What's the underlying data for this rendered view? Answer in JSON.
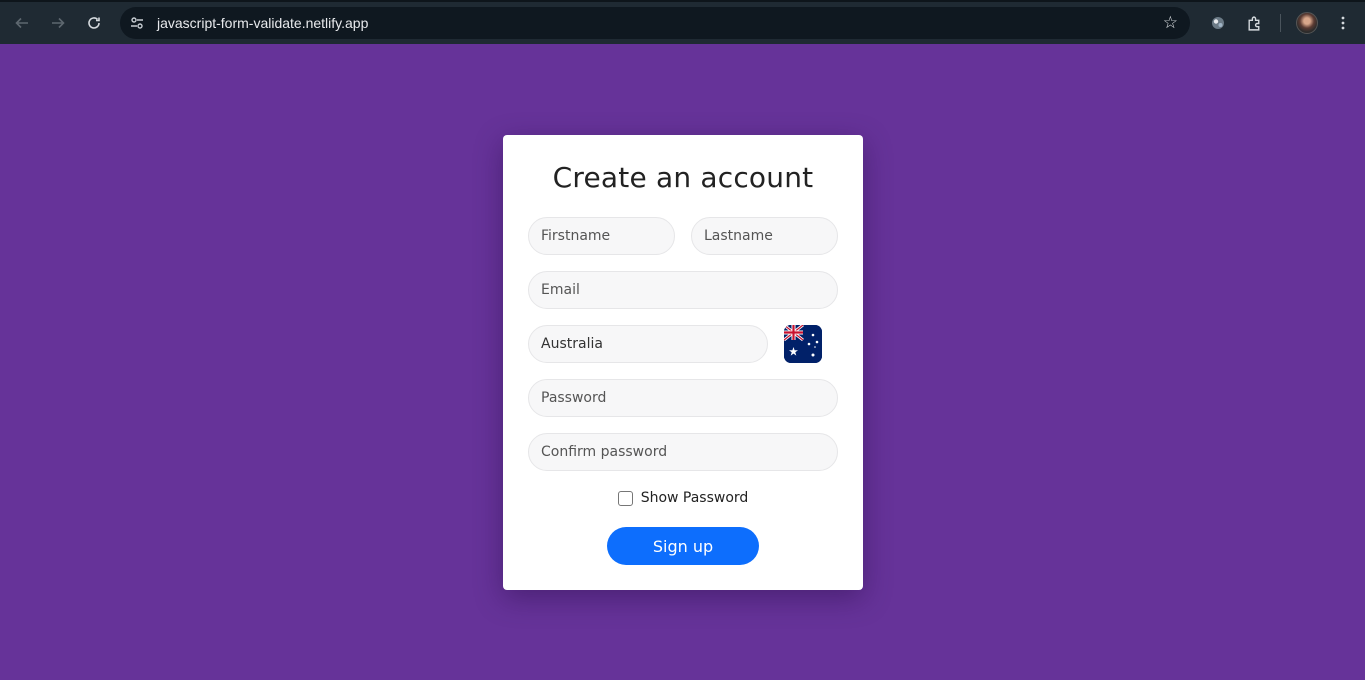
{
  "browser": {
    "url": "javascript-form-validate.netlify.app",
    "icons": [
      "back-arrow-icon",
      "forward-arrow-icon",
      "reload-icon",
      "site-info-icon",
      "bookmark-star-icon",
      "extension-icon",
      "puzzle-extensions-icon",
      "profile-avatar",
      "more-menu-icon"
    ]
  },
  "form": {
    "title": "Create an account",
    "firstname_placeholder": "Firstname",
    "lastname_placeholder": "Lastname",
    "email_placeholder": "Email",
    "country_value": "Australia",
    "password_placeholder": "Password",
    "confirm_placeholder": "Confirm password",
    "show_password_label": "Show Password",
    "signup_label": "Sign up"
  },
  "colors": {
    "page_background": "#663399",
    "button_primary": "#0d6efd"
  }
}
